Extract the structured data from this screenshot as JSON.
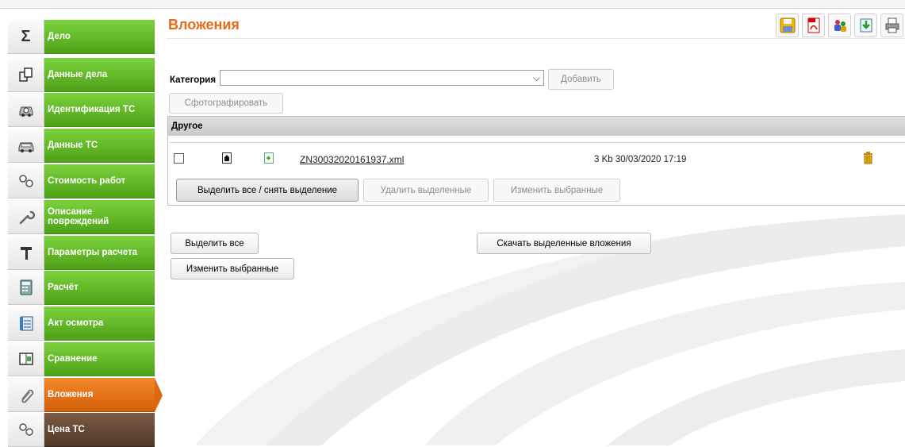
{
  "sidebar": {
    "items": [
      {
        "label": "Дело",
        "icon": "sigma-icon"
      },
      {
        "label": "Данные дела",
        "icon": "documents-icon"
      },
      {
        "label": "Идентификация ТС",
        "icon": "car-search-icon"
      },
      {
        "label": "Данные ТС",
        "icon": "car-icon"
      },
      {
        "label": "Стоимость работ",
        "icon": "gears-icon"
      },
      {
        "label": "Описание повреждений",
        "icon": "wrench-icon"
      },
      {
        "label": "Параметры расчета",
        "icon": "hammer-icon"
      },
      {
        "label": "Расчёт",
        "icon": "calculator-icon"
      },
      {
        "label": "Акт осмотра",
        "icon": "checklist-icon"
      },
      {
        "label": "Сравнение",
        "icon": "compare-icon"
      },
      {
        "label": "Вложения",
        "icon": "paperclip-icon",
        "active": true
      },
      {
        "label": "Цена ТС",
        "icon": "gears-icon"
      }
    ]
  },
  "header": {
    "title": "Вложения",
    "toolbar": [
      "save-icon",
      "pdf-icon",
      "users-add-icon",
      "download-icon",
      "print-icon"
    ]
  },
  "form": {
    "category_label": "Категория",
    "category_value": "",
    "add_button": "Добавить",
    "photo_button": "Сфотографировать"
  },
  "group": {
    "title": "Другое",
    "files": [
      {
        "name": "ZN30032020161937.xml",
        "size": "3 Kb",
        "date": "30/03/2020 17:19"
      }
    ],
    "buttons": {
      "select_all_toggle": "Выделить все / снять выделение",
      "delete_selected": "Удалить выделенные",
      "edit_selected": "Изменить выбранные"
    }
  },
  "actions": {
    "select_all": "Выделить все",
    "download_selected": "Скачать выделенные вложения",
    "edit_selected": "Изменить выбранные"
  },
  "colors": {
    "nav_green": "#5fb424",
    "nav_active": "#e2690f",
    "nav_dark": "#5e4330",
    "title_orange": "#e86a18"
  }
}
